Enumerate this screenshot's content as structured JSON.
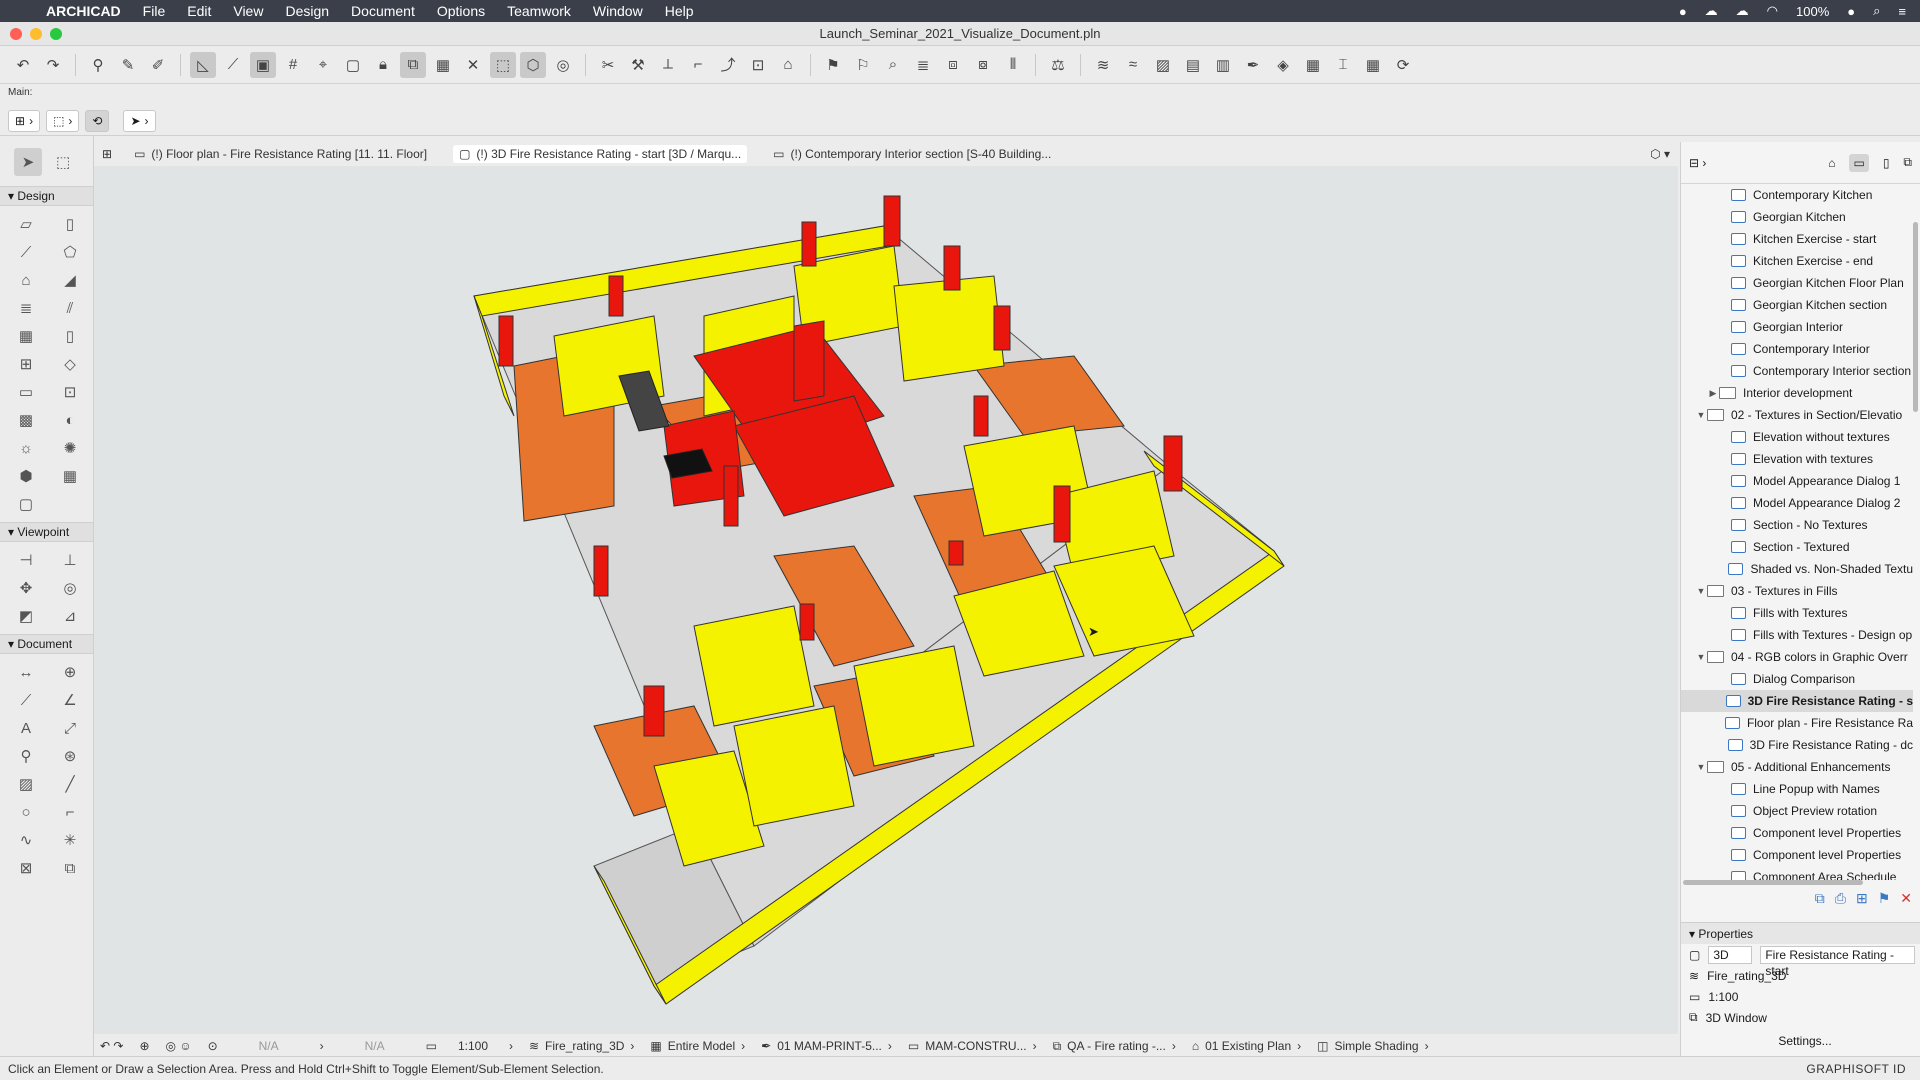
{
  "menubar": {
    "app": "ARCHICAD",
    "items": [
      "File",
      "Edit",
      "View",
      "Design",
      "Document",
      "Options",
      "Teamwork",
      "Window",
      "Help"
    ],
    "battery": "100%"
  },
  "window": {
    "title": "Launch_Seminar_2021_Visualize_Document.pln"
  },
  "mainbar": {
    "label": "Main:"
  },
  "toolbox": {
    "sections": [
      "Design",
      "Viewpoint",
      "Document"
    ]
  },
  "tabs": [
    "(!) Floor plan - Fire Resistance Rating [11. 11. Floor]",
    "(!) 3D Fire Resistance Rating - start [3D / Marqu...",
    "(!) Contemporary Interior section [S-40 Building..."
  ],
  "viewstatus": {
    "na1": "N/A",
    "na2": "N/A",
    "scale": "1:100",
    "layer_combo": "Fire_rating_3D",
    "model_view": "Entire Model",
    "pen_set": "01 MAM-PRINT-5...",
    "construction": "MAM-CONSTRU...",
    "graphic_override": "QA - Fire rating -...",
    "renovation": "01 Existing Plan",
    "shading": "Simple Shading"
  },
  "status_text": "Click an Element or Draw a Selection Area. Press and Hold Ctrl+Shift to Toggle Element/Sub-Element Selection.",
  "brand": "GRAPHISOFT ID",
  "navigator": {
    "rows": [
      {
        "label": "Contemporary Kitchen",
        "level": 2,
        "icon": "3d"
      },
      {
        "label": "Georgian Kitchen",
        "level": 2,
        "icon": "3d"
      },
      {
        "label": "Kitchen Exercise - start",
        "level": 2,
        "icon": "3d"
      },
      {
        "label": "Kitchen Exercise - end",
        "level": 2,
        "icon": "3d"
      },
      {
        "label": "Georgian Kitchen Floor Plan",
        "level": 2,
        "icon": "plan"
      },
      {
        "label": "Georgian Kitchen section",
        "level": 2,
        "icon": "section"
      },
      {
        "label": "Georgian Interior",
        "level": 2,
        "icon": "3d"
      },
      {
        "label": "Contemporary Interior",
        "level": 2,
        "icon": "3d"
      },
      {
        "label": "Contemporary Interior section",
        "level": 2,
        "icon": "section"
      },
      {
        "label": "Interior development",
        "level": 1,
        "icon": "folder",
        "arrow": "▶"
      },
      {
        "label": "02 - Textures in Section/Elevatio",
        "level": 0,
        "icon": "folder",
        "arrow": "▼"
      },
      {
        "label": "Elevation without textures",
        "level": 2,
        "icon": "elev"
      },
      {
        "label": "Elevation with textures",
        "level": 2,
        "icon": "elev"
      },
      {
        "label": "Model Appearance Dialog 1",
        "level": 2,
        "icon": "elev"
      },
      {
        "label": "Model Appearance Dialog 2",
        "level": 2,
        "icon": "elev"
      },
      {
        "label": "Section - No Textures",
        "level": 2,
        "icon": "section"
      },
      {
        "label": "Section - Textured",
        "level": 2,
        "icon": "section"
      },
      {
        "label": "Shaded vs. Non-Shaded Textu",
        "level": 2,
        "icon": "section"
      },
      {
        "label": "03 - Textures in Fills",
        "level": 0,
        "icon": "folder",
        "arrow": "▼"
      },
      {
        "label": "Fills  with Textures",
        "level": 2,
        "icon": "section"
      },
      {
        "label": "Fills  with Textures - Design op",
        "level": 2,
        "icon": "section"
      },
      {
        "label": "04 - RGB colors in Graphic Overr",
        "level": 0,
        "icon": "folder",
        "arrow": "▼"
      },
      {
        "label": "Dialog Comparison",
        "level": 2,
        "icon": "elev"
      },
      {
        "label": "3D Fire Resistance Rating - s",
        "level": 2,
        "icon": "3d",
        "selected": true
      },
      {
        "label": "Floor plan - Fire Resistance Ra",
        "level": 2,
        "icon": "plan"
      },
      {
        "label": "3D Fire Resistance Rating - dc",
        "level": 2,
        "icon": "3d"
      },
      {
        "label": "05 - Additional Enhancements",
        "level": 0,
        "icon": "folder",
        "arrow": "▼"
      },
      {
        "label": "Line Popup with Names",
        "level": 2,
        "icon": "elev"
      },
      {
        "label": "Object Preview rotation",
        "level": 2,
        "icon": "elev"
      },
      {
        "label": "Component level Properties",
        "level": 2,
        "icon": "elev"
      },
      {
        "label": "Component level Properties",
        "level": 2,
        "icon": "3d"
      },
      {
        "label": "Component Area Schedule",
        "level": 2,
        "icon": "elev"
      }
    ]
  },
  "properties": {
    "header": "Properties",
    "id": "3D",
    "name": "Fire Resistance Rating - start",
    "layer": "Fire_rating_3D",
    "scale": "1:100",
    "window": "3D Window",
    "settings": "Settings..."
  },
  "colors": {
    "fire_red": "#e8160c",
    "fire_yellow": "#f5f200",
    "fire_orange": "#e8752e",
    "viewport_bg": "#e1e4e5"
  }
}
